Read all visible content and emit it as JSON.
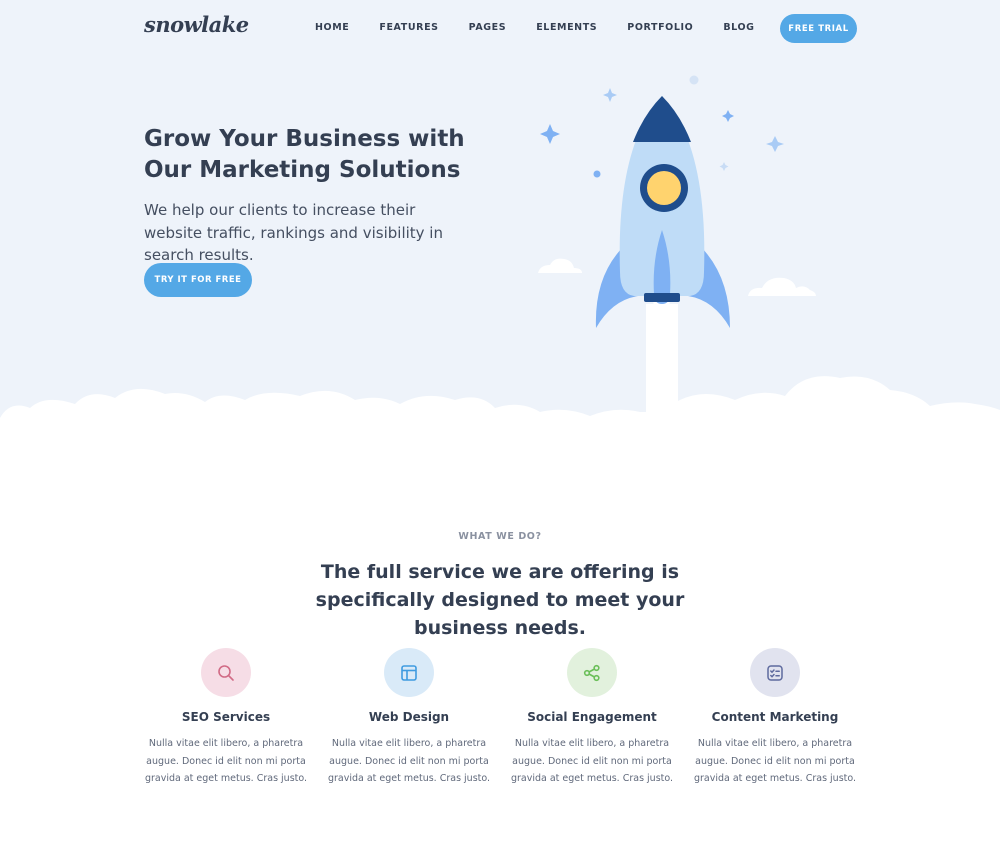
{
  "brand": {
    "logo_text": "snowlake"
  },
  "nav": {
    "items": [
      {
        "label": "HOME"
      },
      {
        "label": "FEATURES"
      },
      {
        "label": "PAGES"
      },
      {
        "label": "ELEMENTS"
      },
      {
        "label": "PORTFOLIO"
      },
      {
        "label": "BLOG"
      }
    ],
    "cta_label": "FREE TRIAL"
  },
  "hero": {
    "title": "Grow Your Business with Our Marketing Solutions",
    "subtitle": "We help our clients to increase their website traffic, rankings and visibility in search results.",
    "cta_label": "TRY IT FOR FREE"
  },
  "services_section": {
    "eyebrow": "WHAT WE DO?",
    "title": "The full service we are offering is specifically designed to meet your business needs.",
    "items": [
      {
        "name": "SEO Services",
        "description": "Nulla vitae elit libero, a pharetra augue. Donec id elit non mi porta gravida at eget metus. Cras justo.",
        "icon": "search-icon",
        "color": "#d16b86",
        "bg": "#f6dde6"
      },
      {
        "name": "Web Design",
        "description": "Nulla vitae elit libero, a pharetra augue. Donec id elit non mi porta gravida at eget metus. Cras justo.",
        "icon": "browser-layout-icon",
        "color": "#3f9be0",
        "bg": "#d9eaf8"
      },
      {
        "name": "Social Engagement",
        "description": "Nulla vitae elit libero, a pharetra augue. Donec id elit non mi porta gravida at eget metus. Cras justo.",
        "icon": "share-icon",
        "color": "#6bbf59",
        "bg": "#e2f1dd"
      },
      {
        "name": "Content Marketing",
        "description": "Nulla vitae elit libero, a pharetra augue. Donec id elit non mi porta gravida at eget metus. Cras justo.",
        "icon": "checklist-icon",
        "color": "#5e6a9e",
        "bg": "#e1e3ef"
      }
    ]
  },
  "colors": {
    "accent": "#54a8e6",
    "hero_bg": "#eef3fa",
    "heading": "#343f52",
    "rocket_dark": "#1f4d8c",
    "rocket_body": "#bfdcf7",
    "rocket_wing": "#7fb1f3",
    "porthole": "#ffd36e"
  }
}
